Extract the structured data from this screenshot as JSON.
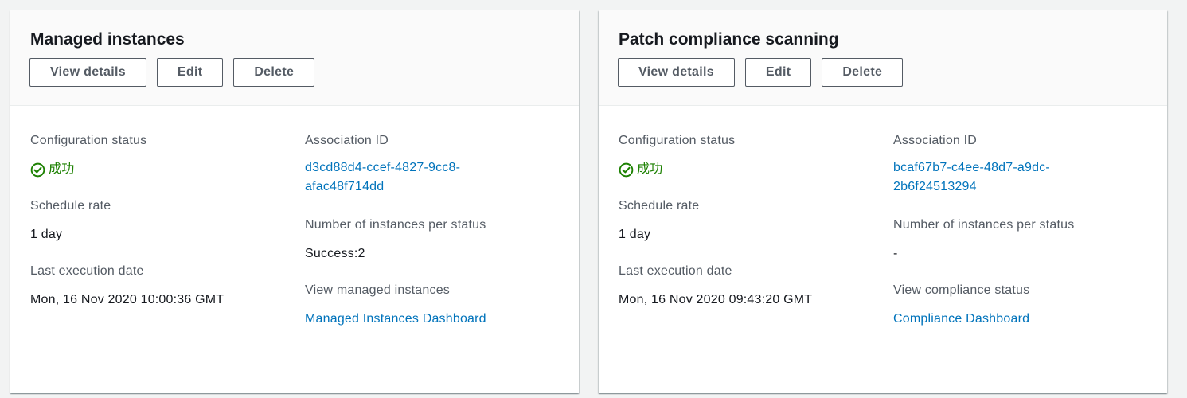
{
  "cards": [
    {
      "title": "Managed instances",
      "buttons": {
        "view": "View details",
        "edit": "Edit",
        "delete": "Delete"
      },
      "config_status_label": "Configuration status",
      "config_status_value": "成功",
      "schedule_label": "Schedule rate",
      "schedule_value": "1 day",
      "last_exec_label": "Last execution date",
      "last_exec_value": "Mon, 16 Nov 2020 10:00:36 GMT",
      "assoc_label": "Association ID",
      "assoc_line1": "d3cd88d4-ccef-4827-9cc8-",
      "assoc_line2": "afac48f714dd",
      "instances_label": "Number of instances per status",
      "instances_value": "Success:2",
      "view_label": "View managed instances",
      "view_link": "Managed Instances Dashboard"
    },
    {
      "title": "Patch compliance scanning",
      "buttons": {
        "view": "View details",
        "edit": "Edit",
        "delete": "Delete"
      },
      "config_status_label": "Configuration status",
      "config_status_value": "成功",
      "schedule_label": "Schedule rate",
      "schedule_value": "1 day",
      "last_exec_label": "Last execution date",
      "last_exec_value": "Mon, 16 Nov 2020 09:43:20 GMT",
      "assoc_label": "Association ID",
      "assoc_line1": "bcaf67b7-c4ee-48d7-a9dc-",
      "assoc_line2": "2b6f24513294",
      "instances_label": "Number of instances per status",
      "instances_value": "-",
      "view_label": "View compliance status",
      "view_link": "Compliance Dashboard"
    }
  ],
  "colors": {
    "success": "#1d8102",
    "link": "#0073bb",
    "label": "#545b64"
  }
}
